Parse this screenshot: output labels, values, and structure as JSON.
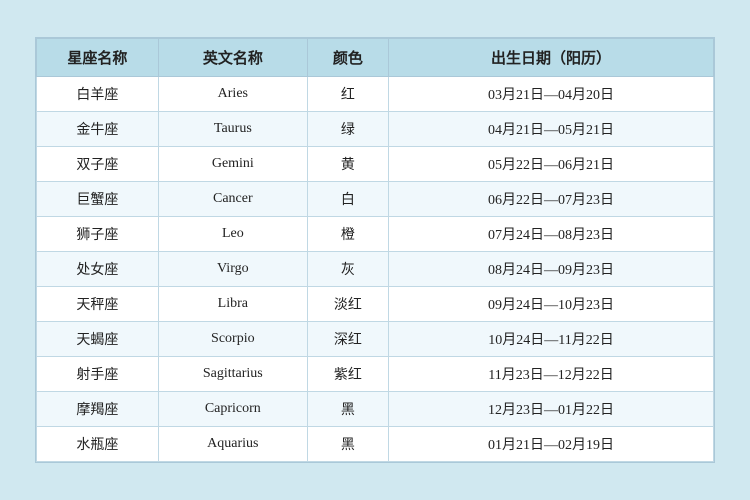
{
  "table": {
    "headers": [
      "星座名称",
      "英文名称",
      "颜色",
      "出生日期（阳历）"
    ],
    "rows": [
      {
        "chinese": "白羊座",
        "english": "Aries",
        "color": "红",
        "date": "03月21日—04月20日"
      },
      {
        "chinese": "金牛座",
        "english": "Taurus",
        "color": "绿",
        "date": "04月21日—05月21日"
      },
      {
        "chinese": "双子座",
        "english": "Gemini",
        "color": "黄",
        "date": "05月22日—06月21日"
      },
      {
        "chinese": "巨蟹座",
        "english": "Cancer",
        "color": "白",
        "date": "06月22日—07月23日"
      },
      {
        "chinese": "狮子座",
        "english": "Leo",
        "color": "橙",
        "date": "07月24日—08月23日"
      },
      {
        "chinese": "处女座",
        "english": "Virgo",
        "color": "灰",
        "date": "08月24日—09月23日"
      },
      {
        "chinese": "天秤座",
        "english": "Libra",
        "color": "淡红",
        "date": "09月24日—10月23日"
      },
      {
        "chinese": "天蝎座",
        "english": "Scorpio",
        "color": "深红",
        "date": "10月24日—11月22日"
      },
      {
        "chinese": "射手座",
        "english": "Sagittarius",
        "color": "紫红",
        "date": "11月23日—12月22日"
      },
      {
        "chinese": "摩羯座",
        "english": "Capricorn",
        "color": "黑",
        "date": "12月23日—01月22日"
      },
      {
        "chinese": "水瓶座",
        "english": "Aquarius",
        "color": "黑",
        "date": "01月21日—02月19日"
      }
    ]
  }
}
